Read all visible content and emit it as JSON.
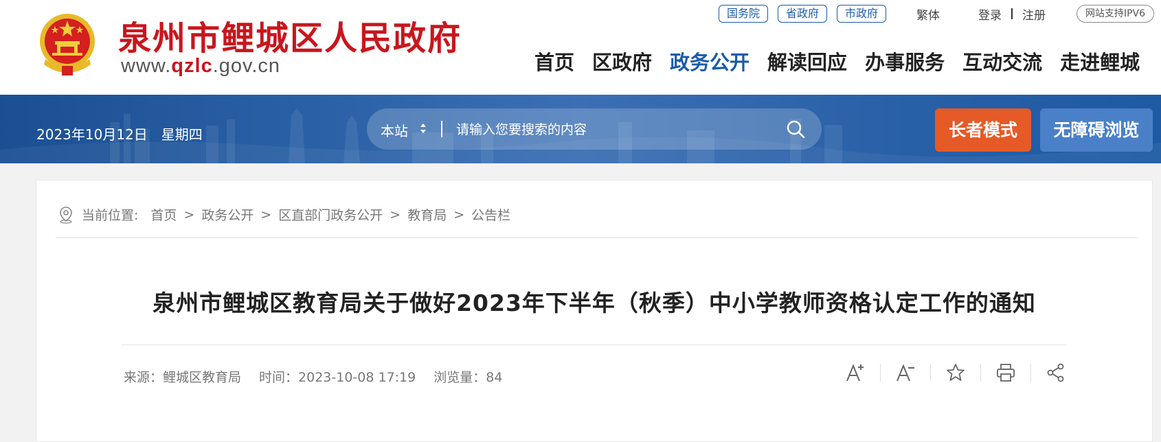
{
  "brand": {
    "title": "泉州市鲤城区人民政府",
    "url_prefix": "www.",
    "url_highlight": "qzlc",
    "url_suffix": ".gov.cn"
  },
  "toplinks": {
    "pills": [
      "国务院",
      "省政府",
      "市政府"
    ],
    "traditional": "繁体",
    "login": "登录",
    "register": "注册",
    "ipv6": "网站支持IPV6"
  },
  "nav": [
    {
      "label": "首页"
    },
    {
      "label": "区政府"
    },
    {
      "label": "政务公开",
      "active": true
    },
    {
      "label": "解读回应"
    },
    {
      "label": "办事服务"
    },
    {
      "label": "互动交流"
    },
    {
      "label": "走进鲤城"
    }
  ],
  "banner": {
    "date": "2023年10月12日",
    "weekday": "星期四",
    "search_scope": "本站",
    "search_placeholder": "请输入您要搜索的内容",
    "elder_mode": "长者模式",
    "accessible": "无障碍浏览"
  },
  "breadcrumb": {
    "label": "当前位置:",
    "items": [
      "首页",
      "政务公开",
      "区直部门政务公开",
      "教育局",
      "公告栏"
    ],
    "separator": ">"
  },
  "article": {
    "title": "泉州市鲤城区教育局关于做好2023年下半年（秋季）中小学教师资格认定工作的通知",
    "source": "来源：鲤城区教育局",
    "time": "时间：2023-10-08 17:19",
    "views": "浏览量：84"
  },
  "tools": [
    {
      "icon": "font-increase-icon",
      "glyph": "A⁺"
    },
    {
      "icon": "font-decrease-icon",
      "glyph": "A⁻"
    },
    {
      "icon": "star-icon"
    },
    {
      "icon": "print-icon"
    },
    {
      "icon": "share-icon"
    }
  ],
  "colors": {
    "brand_red": "#c8161d",
    "nav_blue": "#1a5ba9",
    "elder_orange": "#e55a26",
    "access_blue": "#4a80c8"
  }
}
